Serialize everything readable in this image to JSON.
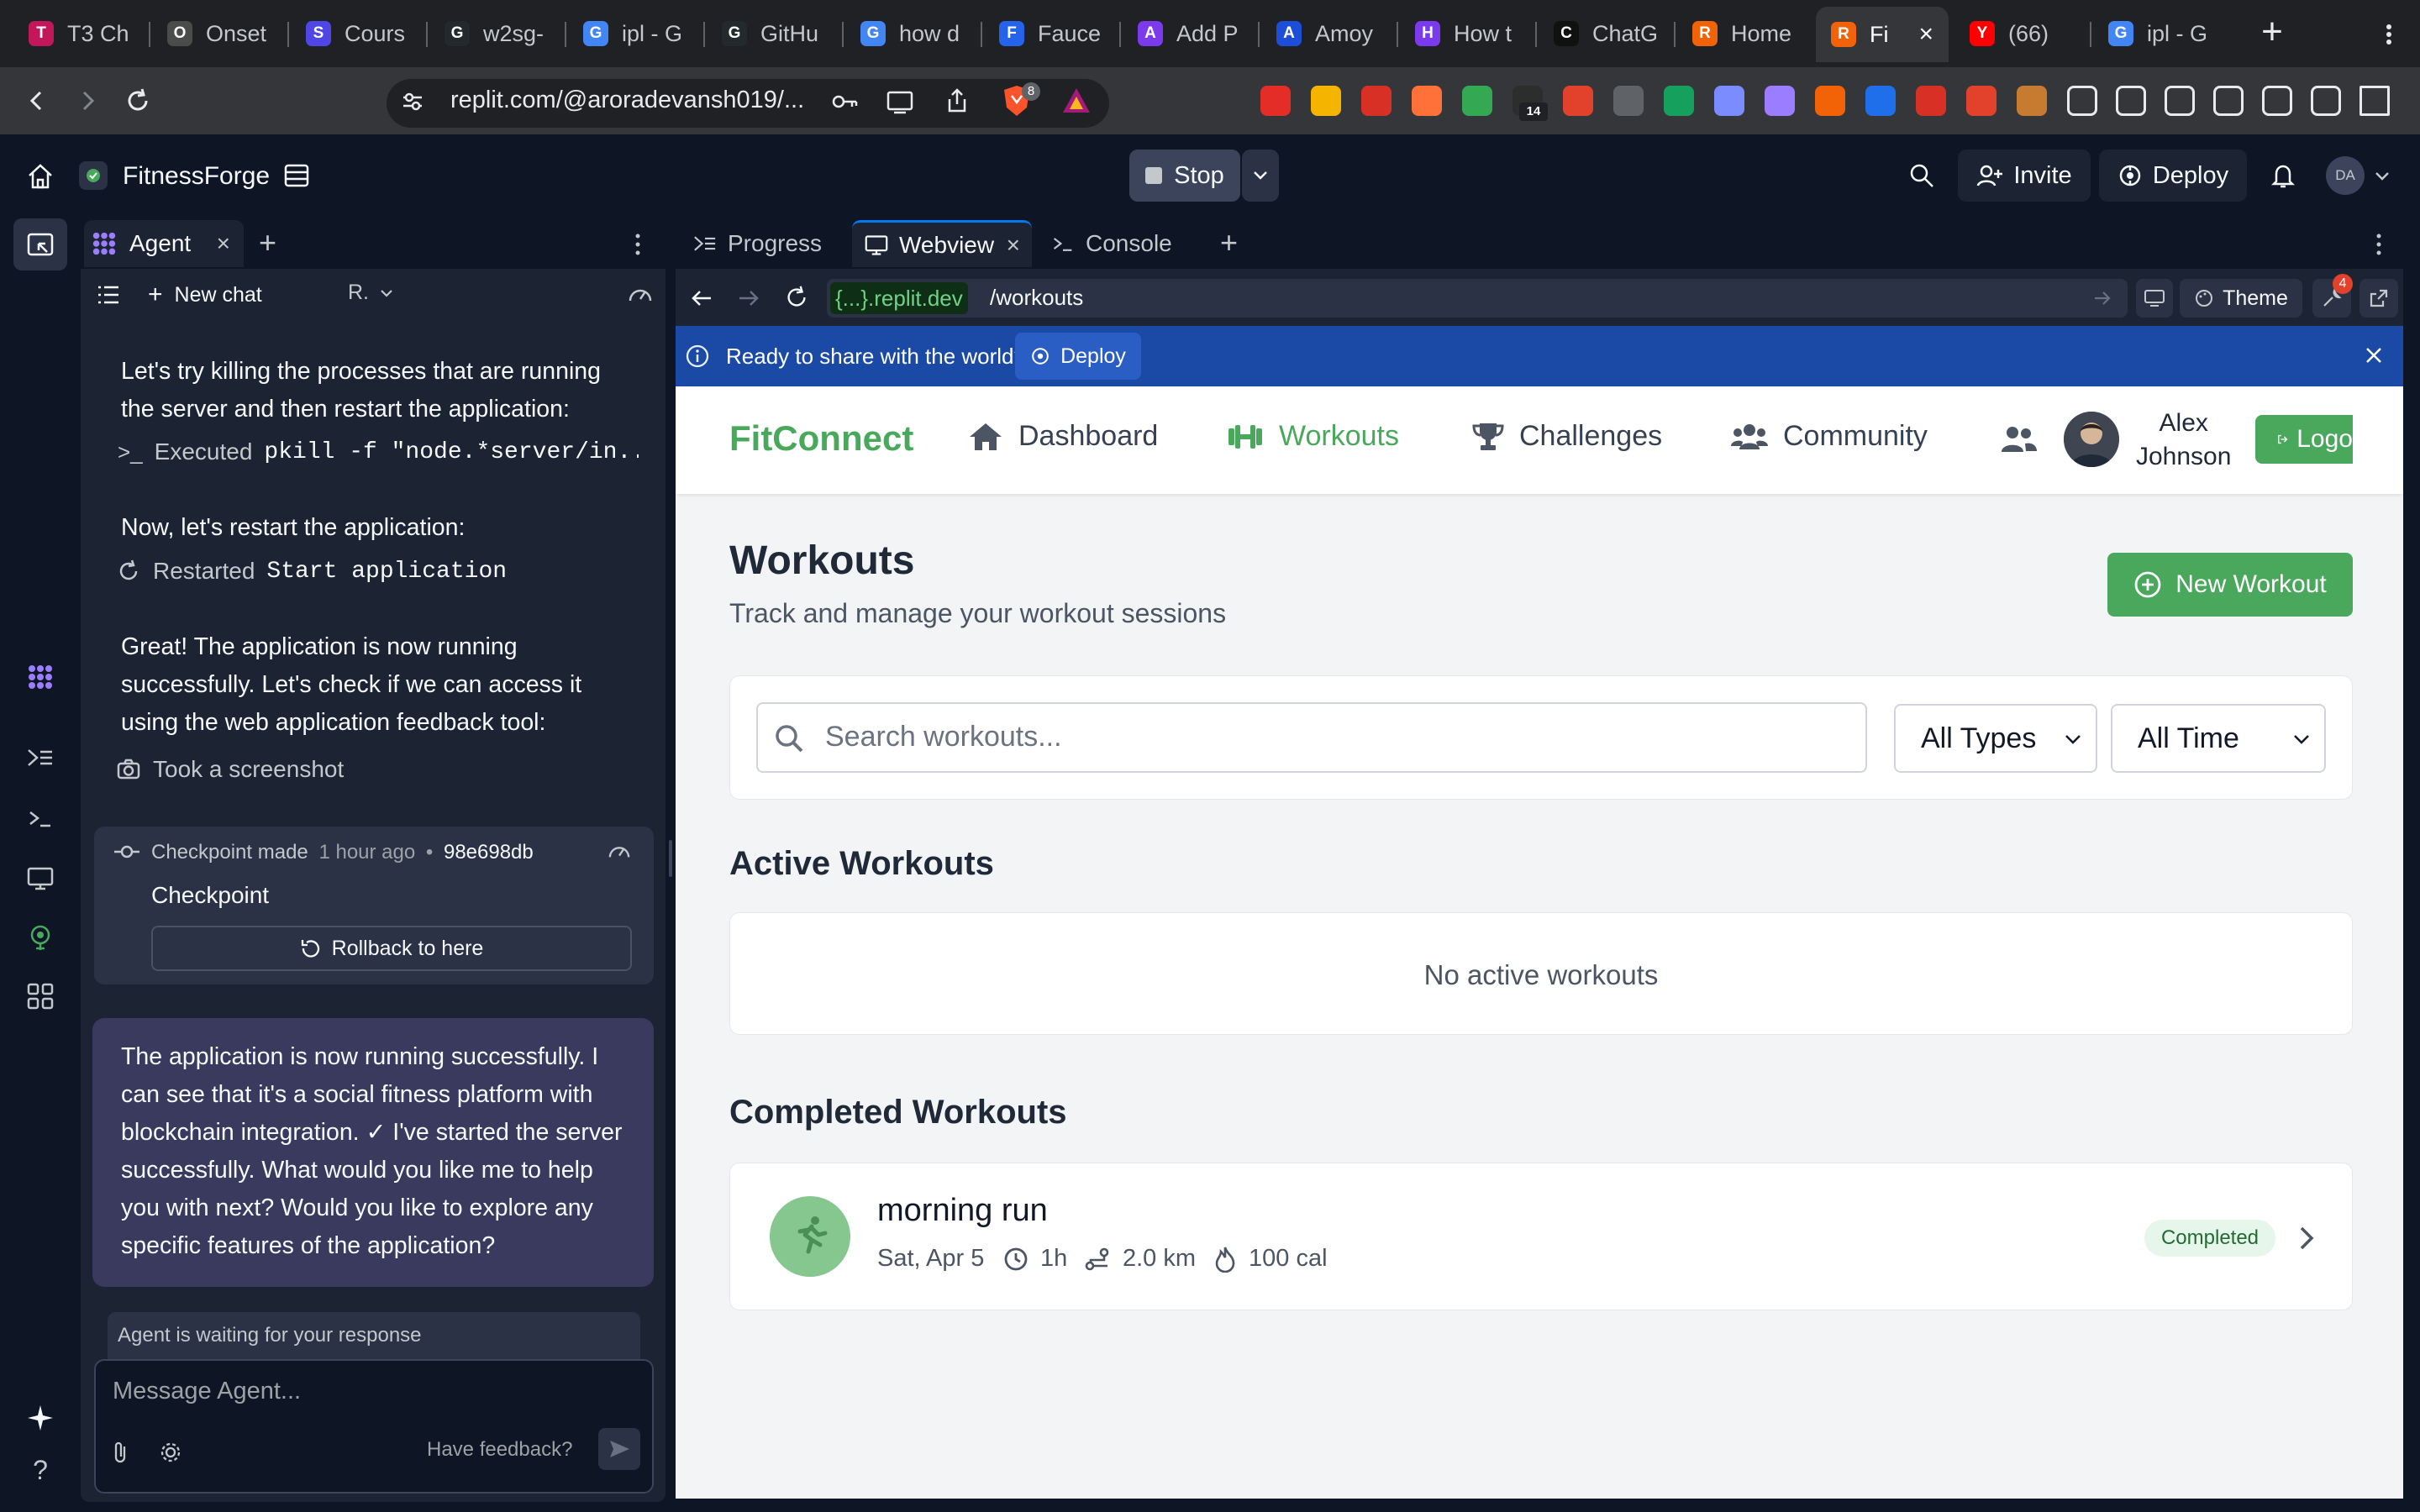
{
  "browser": {
    "tabs": [
      {
        "label": "T3 Ch",
        "color": "#c2185b",
        "glyph": "T"
      },
      {
        "label": "Onset",
        "color": "#4b4b4b",
        "glyph": "O"
      },
      {
        "label": "Cours",
        "color": "#4f46e5",
        "glyph": "S"
      },
      {
        "label": "w2sg-",
        "color": "#24292e",
        "glyph": "G"
      },
      {
        "label": "ipl - G",
        "color": "#4285f4",
        "glyph": "G"
      },
      {
        "label": "GitHu",
        "color": "#24292e",
        "glyph": "G"
      },
      {
        "label": "how d",
        "color": "#4285f4",
        "glyph": "G"
      },
      {
        "label": "Fauce",
        "color": "#2563eb",
        "glyph": "F"
      },
      {
        "label": "Add P",
        "color": "#7c3aed",
        "glyph": "A"
      },
      {
        "label": "Amoy",
        "color": "#1d4ed8",
        "glyph": "A"
      },
      {
        "label": "How t",
        "color": "#7c3aed",
        "glyph": "H"
      },
      {
        "label": "ChatG",
        "color": "#111111",
        "glyph": "C"
      },
      {
        "label": "Home",
        "color": "#f26207",
        "glyph": "R"
      },
      {
        "label": "Fi",
        "color": "#f26207",
        "glyph": "R"
      },
      {
        "label": "(66)",
        "color": "#ff0000",
        "glyph": "Y"
      },
      {
        "label": "ipl - G",
        "color": "#4285f4",
        "glyph": "G"
      }
    ],
    "active_tab_index": 13,
    "url": "replit.com/@aroradevansh019/...",
    "brave_badge": "8",
    "ext_badge": "14"
  },
  "replit": {
    "project_name": "FitnessForge",
    "stop_label": "Stop",
    "invite_label": "Invite",
    "deploy_label": "Deploy",
    "user_initials": "DA"
  },
  "agent": {
    "tab_label": "Agent",
    "new_chat_label": "New chat",
    "model_label": "R.",
    "messages": [
      {
        "text": "Let's try killing the processes that are running the server and then restart the application:"
      },
      {
        "tool": "Executed",
        "code": "pkill -f \"node.*server/in..."
      },
      {
        "text": "Now, let's restart the application:"
      },
      {
        "tool": "Restarted",
        "code": "Start application"
      },
      {
        "text": "Great! The application is now running successfully. Let's check if we can access it using the web application feedback tool:"
      },
      {
        "tool": "Took a screenshot",
        "code": ""
      }
    ],
    "checkpoint": {
      "made_label": "Checkpoint made",
      "time": "1 hour ago",
      "hash": "98e698db",
      "title": "Checkpoint",
      "rollback_label": "Rollback to here"
    },
    "final_message": "The application is now running successfully. I can see that it's a social fitness platform with blockchain integration. ✓ I've started the server successfully. What would you like me to help you with next? Would you like to explore any specific features of the application?",
    "waiting_label": "Agent is waiting for your response",
    "input_placeholder": "Message Agent...",
    "feedback_label": "Have feedback?"
  },
  "workspace": {
    "tabs": [
      "Progress",
      "Webview",
      "Console"
    ],
    "active_tab": "Webview",
    "dev_domain": "{...}.replit.dev",
    "path": "/workouts",
    "theme_label": "Theme",
    "tools_badge": "4",
    "banner_text": "Ready to share with the world?",
    "banner_deploy": "Deploy"
  },
  "app": {
    "brand": "FitConnect",
    "nav": [
      "Dashboard",
      "Workouts",
      "Challenges",
      "Community"
    ],
    "active_nav": "Workouts",
    "user_first": "Alex",
    "user_last": "Johnson",
    "logout_label": "Logo",
    "page_title": "Workouts",
    "page_subtitle": "Track and manage your workout sessions",
    "new_workout_label": "New Workout",
    "search_placeholder": "Search workouts...",
    "type_filter": "All Types",
    "time_filter": "All Time",
    "active_heading": "Active Workouts",
    "active_empty": "No active workouts",
    "completed_heading": "Completed Workouts",
    "completed": [
      {
        "name": "morning run",
        "date": "Sat, Apr 5",
        "duration": "1h",
        "distance": "2.0 km",
        "calories": "100 cal",
        "status": "Completed"
      }
    ],
    "colors": {
      "accent_green": "#4aa85c",
      "replit_blue": "#0079f2"
    }
  }
}
